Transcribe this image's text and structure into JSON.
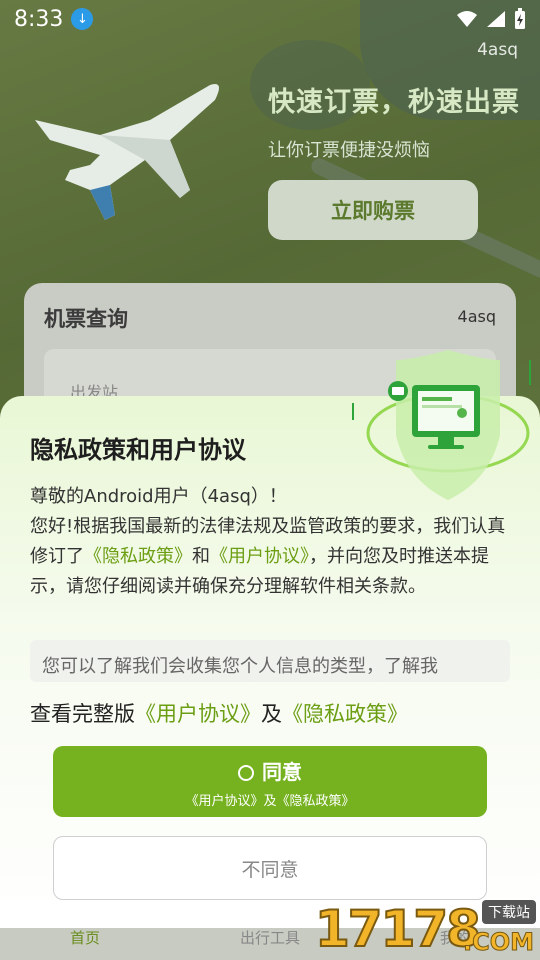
{
  "status_bar": {
    "time": "8:33"
  },
  "header": {
    "brand_tag": "4asq"
  },
  "hero": {
    "title": "快速订票，秒速出票",
    "subtitle": "让你订票便捷没烦恼",
    "buy_label": "立即购票"
  },
  "query_card": {
    "title": "机票查询",
    "tag": "4asq",
    "departure_label": "出发站"
  },
  "bottom_nav": {
    "items": [
      {
        "label": "首页"
      },
      {
        "label": "出行工具"
      },
      {
        "label": "我的"
      }
    ]
  },
  "dialog": {
    "title": "隐私政策和用户协议",
    "greeting": "尊敬的Android用户（4asq）！",
    "body_part1": "您好!根据我国最新的法律法规及监管政策的要求，我们认真修订了",
    "privacy_link": "《隐私政策》",
    "and": "和",
    "user_link": "《用户协议》",
    "body_part2": "，并向您及时推送本提示，请您仔细阅读并确保充分理解软件相关条款。",
    "summary_text": "您可以了解我们会收集您个人信息的类型，了解我",
    "view_full_prefix": "查看完整版",
    "view_full_user_link": "《用户协议》",
    "view_full_and": "及",
    "view_full_privacy_link": "《隐私政策》",
    "agree_label": "同意",
    "agree_sub": "《用户协议》及《隐私政策》",
    "disagree_label": "不同意"
  },
  "watermark": {
    "digits": "17178",
    "site": "下载站",
    "domain": ".COM"
  }
}
